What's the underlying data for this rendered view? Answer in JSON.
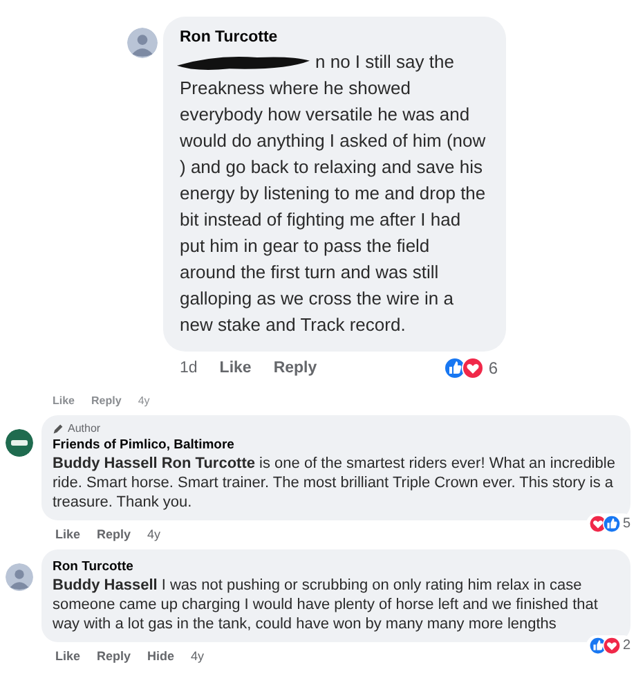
{
  "comments": [
    {
      "kind": "large",
      "avatar": {
        "kind": "photo"
      },
      "name": "Ron Turcotte",
      "redacted_tail": "n no I still say the",
      "text": "Preakness where he showed everybody how versatile he was and would do anything I asked of him (now ) and go back to relaxing and save his energy by listening to me and drop the bit instead of fighting me after I had put him in gear to pass the field around the first turn and was still galloping as we cross the wire in a new stake and Track record.",
      "meta": [
        {
          "kind": "time",
          "label": "1d"
        },
        {
          "kind": "action",
          "label": "Like"
        },
        {
          "kind": "action",
          "label": "Reply"
        }
      ],
      "reactions": [
        {
          "kind": "like"
        },
        {
          "kind": "love"
        }
      ],
      "count": "6"
    },
    {
      "kind": "cut",
      "meta": [
        {
          "kind": "action",
          "label": "Like"
        },
        {
          "kind": "action",
          "label": "Reply"
        },
        {
          "kind": "time",
          "label": "4y"
        }
      ]
    },
    {
      "kind": "compact",
      "avatar": {
        "kind": "logo"
      },
      "author_badge": "Author",
      "name": "Friends of Pimlico, Baltimore",
      "text": "**Buddy Hassell Ron Turcotte** is one of the smartest riders ever! What an incredible ride. Smart horse. Smart trainer. The most brilliant Triple Crown ever. This story is a treasure. Thank you.",
      "meta": [
        {
          "kind": "action",
          "label": "Like"
        },
        {
          "kind": "action",
          "label": "Reply"
        },
        {
          "kind": "time",
          "label": "4y"
        }
      ],
      "reactions": [
        {
          "kind": "love"
        },
        {
          "kind": "like"
        }
      ],
      "count": "5"
    },
    {
      "kind": "compact",
      "avatar": {
        "kind": "photo"
      },
      "name": "Ron Turcotte",
      "text": "**Buddy Hassell** I was not pushing or scrubbing on only rating him relax in case someone came up charging I would have plenty of horse left and we finished that way with a lot gas in the tank, could have won by many many more lengths",
      "meta": [
        {
          "kind": "action",
          "label": "Like"
        },
        {
          "kind": "action",
          "label": "Reply"
        },
        {
          "kind": "action",
          "label": "Hide"
        },
        {
          "kind": "time",
          "label": "4y"
        }
      ],
      "reactions": [
        {
          "kind": "like"
        },
        {
          "kind": "love"
        }
      ],
      "count": "2"
    }
  ]
}
